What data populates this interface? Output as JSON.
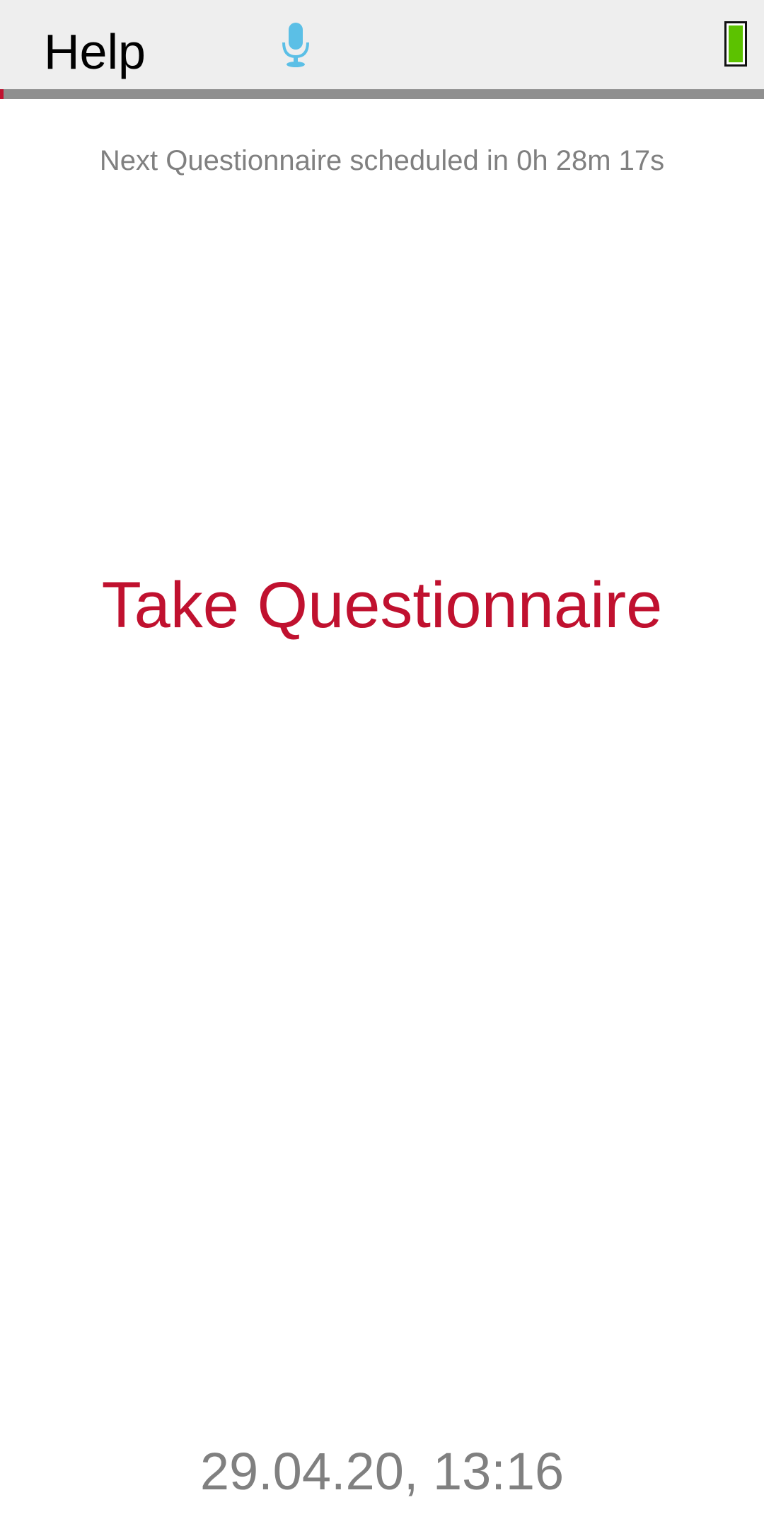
{
  "header": {
    "help_label": "Help",
    "mic_icon": "microphone-icon",
    "battery_icon": "battery-icon",
    "battery_level": 1.0
  },
  "progress": {
    "value": 0.005
  },
  "main": {
    "schedule_text": "Next Questionnaire scheduled in 0h 28m 17s",
    "take_label": "Take Questionnaire"
  },
  "footer": {
    "datetime": "29.04.20, 13:16"
  },
  "colors": {
    "accent": "#c0112f",
    "mic": "#5bbfe6",
    "battery": "#5cc200",
    "muted_text": "#808080",
    "header_bg": "#eeeeee"
  }
}
